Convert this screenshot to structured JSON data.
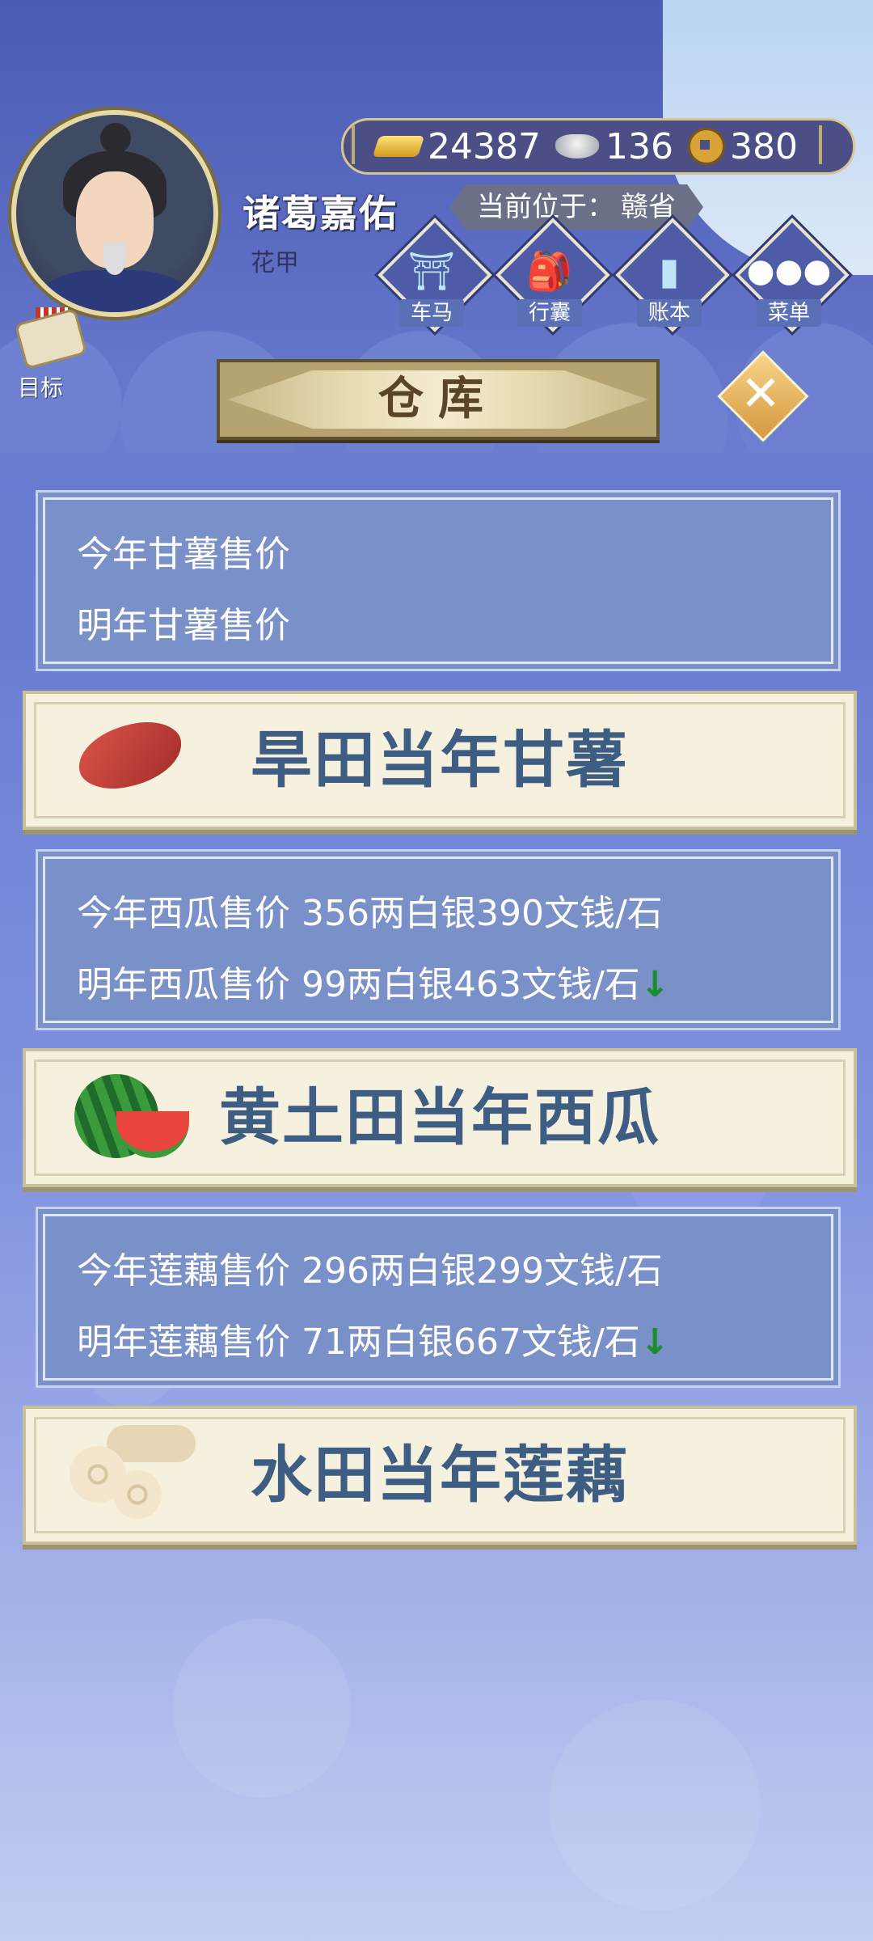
{
  "player": {
    "name": "诸葛嘉佑",
    "age_label": "花甲",
    "location_label": "当前位于：",
    "location": "赣省"
  },
  "currency": {
    "gold": "24387",
    "silver": "136",
    "copper": "380"
  },
  "menu": [
    {
      "label": "车马",
      "icon": "carriage-icon"
    },
    {
      "label": "行囊",
      "icon": "bag-icon"
    },
    {
      "label": "账本",
      "icon": "ledger-icon"
    },
    {
      "label": "菜单",
      "icon": "more-icon"
    }
  ],
  "target": {
    "label": "目标"
  },
  "page_title": "仓库",
  "price_panels": [
    {
      "line1": "今年甘薯售价",
      "line2": "明年甘薯售价",
      "trend": ""
    },
    {
      "line1": "今年西瓜售价 356两白银390文钱/石",
      "line2": "明年西瓜售价 99两白银463文钱/石",
      "trend": "↓"
    },
    {
      "line1": "今年莲藕售价 296两白银299文钱/石",
      "line2": "明年莲藕售价 71两白银667文钱/石",
      "trend": "↓"
    }
  ],
  "crops": [
    {
      "name": "旱田当年甘薯",
      "icon": "sweet-potato-icon"
    },
    {
      "name": "黄土田当年西瓜",
      "icon": "watermelon-icon"
    },
    {
      "name": "水田当年莲藕",
      "icon": "lotus-root-icon"
    }
  ],
  "colors": {
    "background": "#6c7fd4",
    "panel": "#7a90c8",
    "crop_text": "#3d5d82",
    "trend_down": "#1c8d2c"
  }
}
